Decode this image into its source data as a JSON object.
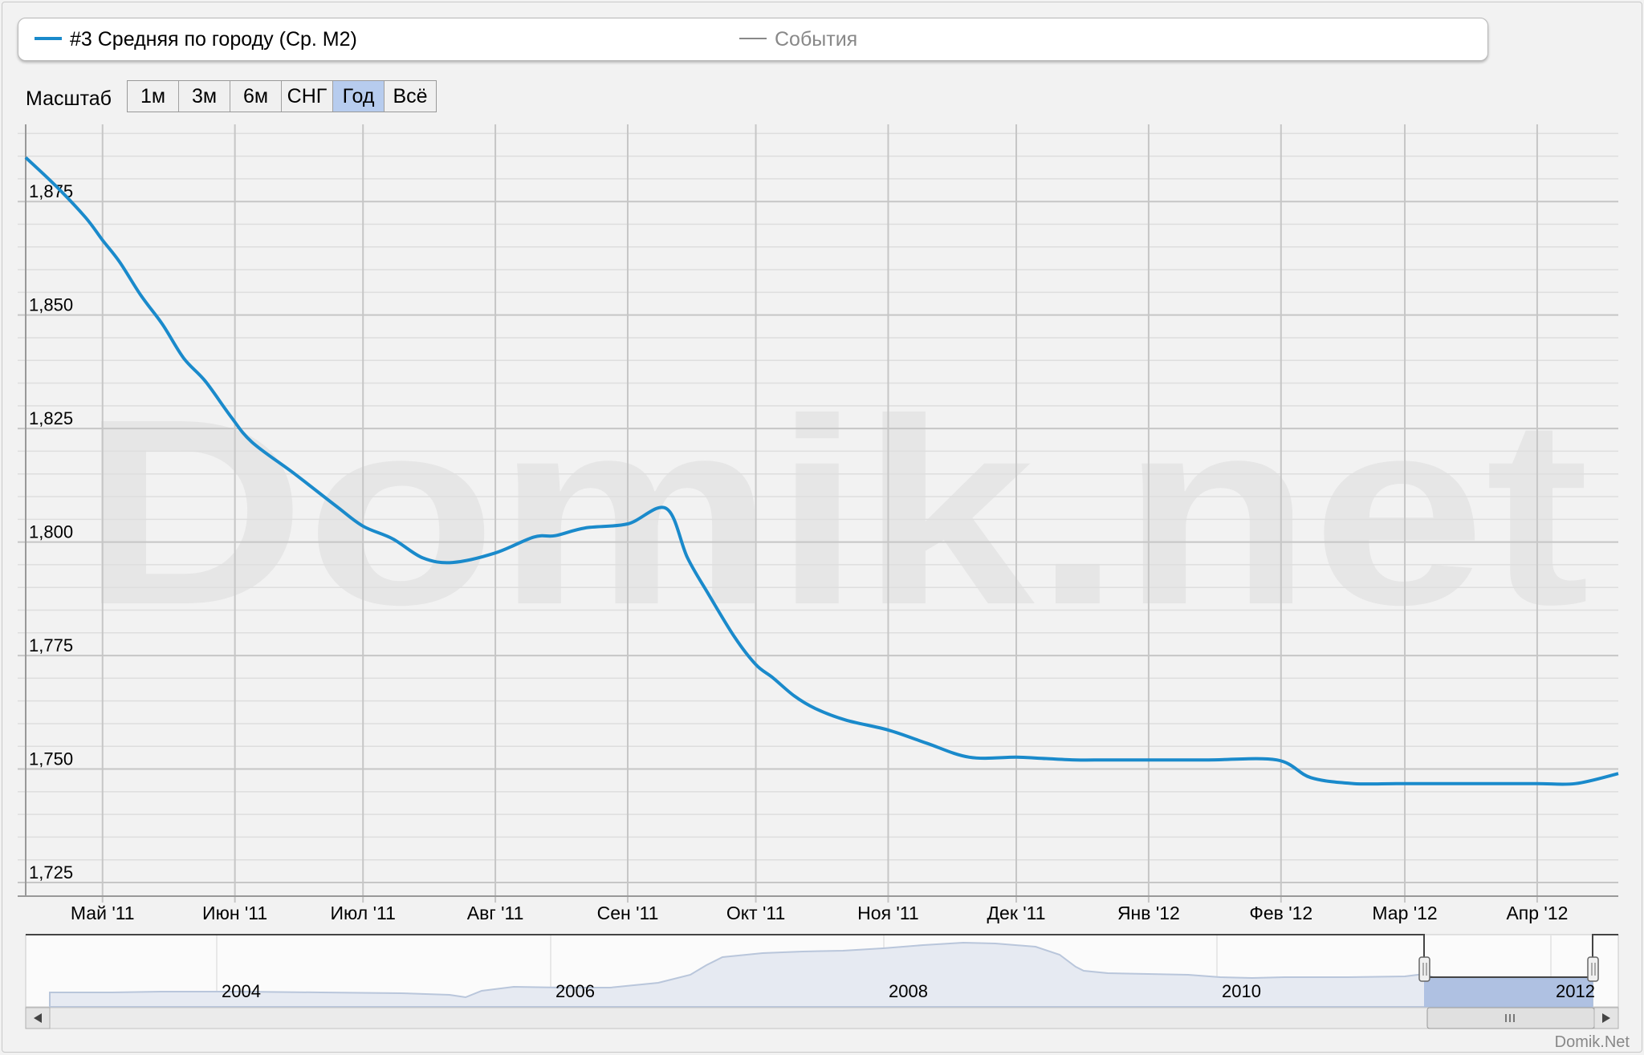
{
  "legend": {
    "series_label": "#3 Средняя по городу (Ср. М2)",
    "series_color": "#1a8acb",
    "events_label": "События",
    "events_color": "#888888"
  },
  "zoom": {
    "label": "Масштаб",
    "buttons": [
      "1м",
      "3м",
      "6м",
      "СНГ",
      "Год",
      "Всё"
    ],
    "active": "Год"
  },
  "watermark": "Domik.net",
  "footer": "Domik.Net",
  "chart_data": {
    "type": "line",
    "x_ticks": [
      "Май '11",
      "Июн '11",
      "Июл '11",
      "Авг '11",
      "Сен '11",
      "Окт '11",
      "Ноя '11",
      "Дек '11",
      "Янв '12",
      "Фев '12",
      "Мар '12",
      "Апр '12"
    ],
    "y_ticks": [
      "1,725",
      "1,750",
      "1,775",
      "1,800",
      "1,825",
      "1,850",
      "1,875"
    ],
    "ylim": [
      1722,
      1892
    ],
    "series": [
      {
        "name": "#3 Средняя по городу (Ср. М2)",
        "x": [
          "2011-04-13",
          "2011-04-20",
          "2011-04-27",
          "2011-05-01",
          "2011-05-05",
          "2011-05-10",
          "2011-05-15",
          "2011-05-20",
          "2011-05-25",
          "2011-05-31",
          "2011-06-05",
          "2011-06-15",
          "2011-06-25",
          "2011-07-01",
          "2011-07-08",
          "2011-07-15",
          "2011-07-22",
          "2011-08-01",
          "2011-08-10",
          "2011-08-15",
          "2011-08-22",
          "2011-09-01",
          "2011-09-10",
          "2011-09-15",
          "2011-09-20",
          "2011-09-26",
          "2011-10-01",
          "2011-10-05",
          "2011-10-10",
          "2011-10-15",
          "2011-10-22",
          "2011-11-01",
          "2011-11-10",
          "2011-11-20",
          "2011-12-01",
          "2011-12-08",
          "2011-12-15",
          "2011-12-22",
          "2012-01-01",
          "2012-01-15",
          "2012-01-31",
          "2012-02-08",
          "2012-02-18",
          "2012-02-28",
          "2012-03-10",
          "2012-03-20",
          "2012-04-01",
          "2012-04-10",
          "2012-04-20"
        ],
        "values": [
          1884.7,
          1878.5,
          1871.5,
          1866.5,
          1861.7,
          1854.3,
          1848.0,
          1840.5,
          1835.5,
          1827.7,
          1822.0,
          1815.0,
          1807.7,
          1803.5,
          1800.7,
          1796.5,
          1795.5,
          1797.6,
          1801.1,
          1801.4,
          1803.1,
          1804.0,
          1807.4,
          1796.5,
          1788.4,
          1779.1,
          1773.0,
          1770.1,
          1766.1,
          1763.3,
          1760.8,
          1758.6,
          1755.7,
          1752.6,
          1752.6,
          1752.3,
          1752.0,
          1752.0,
          1752.0,
          1752.0,
          1752.0,
          1748.1,
          1746.8,
          1746.8,
          1746.8,
          1746.8,
          1746.8,
          1746.8,
          1749.0
        ]
      }
    ],
    "x_range": [
      "2011-04-13",
      "2012-04-20"
    ],
    "grid": true,
    "navigator": {
      "year_labels": [
        "2004",
        "2006",
        "2008",
        "2010",
        "2012"
      ],
      "selected_range": [
        "2011-04-13",
        "2012-04-20"
      ]
    }
  }
}
